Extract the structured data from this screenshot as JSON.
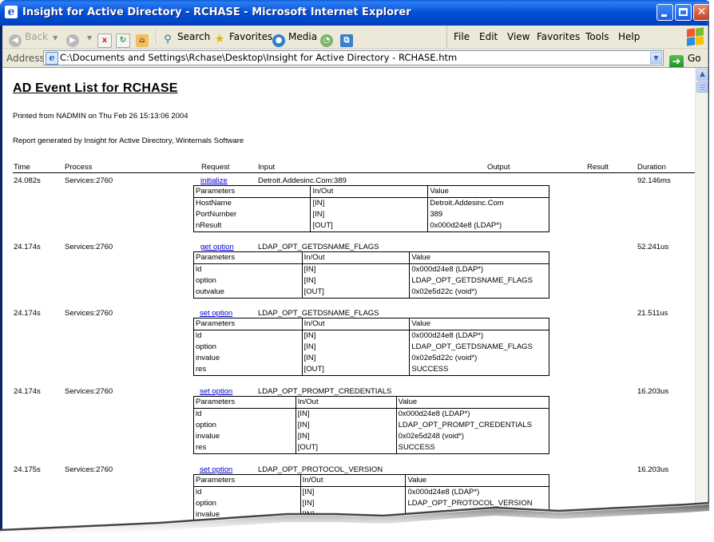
{
  "window": {
    "title": "Insight for Active Directory - RCHASE - Microsoft Internet Explorer",
    "controls": [
      "minimize",
      "maximize",
      "close"
    ]
  },
  "toolbar": {
    "back_label": "Back",
    "search_label": "Search",
    "favorites_label": "Favorites",
    "media_label": "Media"
  },
  "menu": [
    "File",
    "Edit",
    "View",
    "Favorites",
    "Tools",
    "Help"
  ],
  "address": {
    "label": "Address",
    "value": "C:\\Documents and Settings\\Rchase\\Desktop\\Insight for Active Directory - RCHASE.htm",
    "go_label": "Go"
  },
  "report": {
    "title": "AD Event List for RCHASE",
    "printed": "Printed from NADMIN on Thu Feb 26 15:13:06 2004",
    "generated": "Report generated by Insight for Active Directory, Winternals Software",
    "columns": [
      "Time",
      "Process",
      "Request",
      "Input",
      "Output",
      "Result",
      "Duration"
    ],
    "param_headers": [
      "Parameters",
      "In/Out",
      "Value"
    ],
    "events": [
      {
        "time": "24.082s",
        "process": "Services:2760",
        "request": "initialize",
        "input": "Detroit.Addesinc.Com:389",
        "duration": "92.146ms",
        "params": [
          [
            "HostName",
            "[IN]",
            "Detroit.Addesinc.Com"
          ],
          [
            "PortNumber",
            "[IN]",
            "389"
          ],
          [
            "nResult",
            "[OUT]",
            "0x000d24e8 (LDAP*)"
          ]
        ]
      },
      {
        "time": "24.174s",
        "process": "Services:2760",
        "request": "get option",
        "input": "LDAP_OPT_GETDSNAME_FLAGS",
        "duration": "52.241us",
        "params": [
          [
            "ld",
            "[IN]",
            "0x000d24e8 (LDAP*)"
          ],
          [
            "option",
            "[IN]",
            "LDAP_OPT_GETDSNAME_FLAGS"
          ],
          [
            "outvalue",
            "[OUT]",
            "0x02e5d22c (void*)"
          ]
        ]
      },
      {
        "time": "24.174s",
        "process": "Services:2760",
        "request": "set option",
        "input": "LDAP_OPT_GETDSNAME_FLAGS",
        "duration": "21.511us",
        "params": [
          [
            "ld",
            "[IN]",
            "0x000d24e8 (LDAP*)"
          ],
          [
            "option",
            "[IN]",
            "LDAP_OPT_GETDSNAME_FLAGS"
          ],
          [
            "invalue",
            "[IN]",
            "0x02e5d22c (void*)"
          ],
          [
            "res",
            "[OUT]",
            "SUCCESS"
          ]
        ]
      },
      {
        "time": "24.174s",
        "process": "Services:2760",
        "request": "set option",
        "input": "LDAP_OPT_PROMPT_CREDENTIALS",
        "duration": "16.203us",
        "params": [
          [
            "ld",
            "[IN]",
            "0x000d24e8 (LDAP*)"
          ],
          [
            "option",
            "[IN]",
            "LDAP_OPT_PROMPT_CREDENTIALS"
          ],
          [
            "invalue",
            "[IN]",
            "0x02e5d248 (void*)"
          ],
          [
            "res",
            "[OUT]",
            "SUCCESS"
          ]
        ]
      },
      {
        "time": "24.175s",
        "process": "Services:2760",
        "request": "set option",
        "input": "LDAP_OPT_PROTOCOL_VERSION",
        "duration": "16.203us",
        "params": [
          [
            "ld",
            "[IN]",
            "0x000d24e8 (LDAP*)"
          ],
          [
            "option",
            "[IN]",
            "LDAP_OPT_PROTOCOL_VERSION"
          ],
          [
            "invalue",
            "[IN]",
            ""
          ]
        ]
      }
    ]
  }
}
